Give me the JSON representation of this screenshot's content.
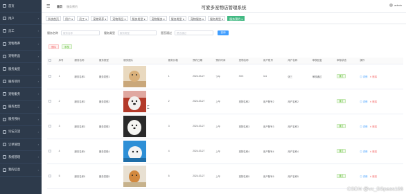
{
  "sidebar": {
    "items": [
      {
        "label": "首页",
        "icon": "home-icon",
        "chevron": ""
      },
      {
        "label": "用户",
        "icon": "user-icon",
        "chevron": "›"
      },
      {
        "label": "员工",
        "icon": "staff-icon",
        "chevron": "›"
      },
      {
        "label": "宠物寄养",
        "icon": "pet-icon",
        "chevron": "›"
      },
      {
        "label": "宠物用品",
        "icon": "goods-icon",
        "chevron": "›"
      },
      {
        "label": "服务类型",
        "icon": "list-icon",
        "chevron": "›"
      },
      {
        "label": "服务项目",
        "icon": "grid-icon",
        "chevron": "›"
      },
      {
        "label": "宠物服务",
        "icon": "service-icon",
        "chevron": "›"
      },
      {
        "label": "服务类型",
        "icon": "type-icon",
        "chevron": "›"
      },
      {
        "label": "服务预约",
        "icon": "calendar-icon",
        "chevron": "›"
      },
      {
        "label": "论坛交流",
        "icon": "chat-icon",
        "chevron": "›"
      },
      {
        "label": "订单管理",
        "icon": "order-icon",
        "chevron": "›"
      },
      {
        "label": "系统管理",
        "icon": "settings-icon",
        "chevron": "›"
      },
      {
        "label": "我的信息",
        "icon": "info-icon",
        "chevron": "›"
      }
    ]
  },
  "header": {
    "title": "可爱多宠物店管理系统",
    "breadcrumb_home": "首页",
    "breadcrumb_current": "服务预约",
    "user": "admin"
  },
  "nav_tabs": [
    {
      "label": "系统首页",
      "active": false
    },
    {
      "label": "用户 ▾",
      "active": false
    },
    {
      "label": "员工 ▾",
      "active": false
    },
    {
      "label": "宠物寄养 ▾",
      "active": false
    },
    {
      "label": "宠物用品 ▾",
      "active": false
    },
    {
      "label": "服务类型 ▾",
      "active": false
    },
    {
      "label": "宠物服务 ▾",
      "active": false
    },
    {
      "label": "服务类型 ▾",
      "active": false
    },
    {
      "label": "宠物服务 ▾",
      "active": false
    },
    {
      "label": "服务类型 ▾",
      "active": false
    },
    {
      "label": "服务预约 ▾",
      "active": true
    }
  ],
  "search": {
    "field1_label": "服务名称",
    "field1_placeholder": "服务名称",
    "field2_label": "服务类型",
    "field2_placeholder": "服务类型",
    "field3_label": "是否通过",
    "field3_placeholder": "是否通过",
    "button": "查询"
  },
  "actions": {
    "delete": "删除",
    "review": "审核"
  },
  "table": {
    "headers": [
      "",
      "序号",
      "服务名称",
      "服务类型",
      "服务图片",
      "服务价格",
      "预约日期",
      "预约时间",
      "宠物名称",
      "用户账号",
      "用户名称",
      "审核回复",
      "审核状态",
      "操作"
    ],
    "rows": [
      {
        "idx": "1",
        "name": "服务名称1",
        "type": "服务类型1",
        "price": "1",
        "date": "2024-03-27",
        "time": "下午",
        "pet": "XXX",
        "account": "111",
        "uname": "张三",
        "reply": "审核通过",
        "status": "通过"
      },
      {
        "idx": "2",
        "name": "服务名称2",
        "type": "服务类型2",
        "price": "2",
        "date": "2024-03-27",
        "time": "上午",
        "pet": "宠物名称2",
        "account": "用户账号2",
        "uname": "用户名称2",
        "reply": "",
        "status": "通过"
      },
      {
        "idx": "3",
        "name": "服务名称3",
        "type": "服务类型3",
        "price": "3",
        "date": "2024-03-27",
        "time": "上午",
        "pet": "宠物名称3",
        "account": "用户账号3",
        "uname": "用户名称3",
        "reply": "",
        "status": "通过"
      },
      {
        "idx": "4",
        "name": "服务名称4",
        "type": "服务类型4",
        "price": "4",
        "date": "2024-03-27",
        "time": "上午",
        "pet": "宠物名称4",
        "account": "用户账号4",
        "uname": "用户名称4",
        "reply": "",
        "status": "通过"
      },
      {
        "idx": "5",
        "name": "服务名称5",
        "type": "服务类型5",
        "price": "5",
        "date": "2024-03-27",
        "time": "上午",
        "pet": "宠物名称5",
        "account": "用户账号5",
        "uname": "用户名称5",
        "reply": "",
        "status": "通过"
      }
    ],
    "op_detail": "详情",
    "op_delete": "删除"
  },
  "watermark": "CSDN @vx_BSpass188",
  "colors": {
    "sidebar": "#2d3a4b",
    "active_tab": "#42b983",
    "primary": "#409eff",
    "danger": "#f56c6c",
    "success": "#67c23a"
  }
}
